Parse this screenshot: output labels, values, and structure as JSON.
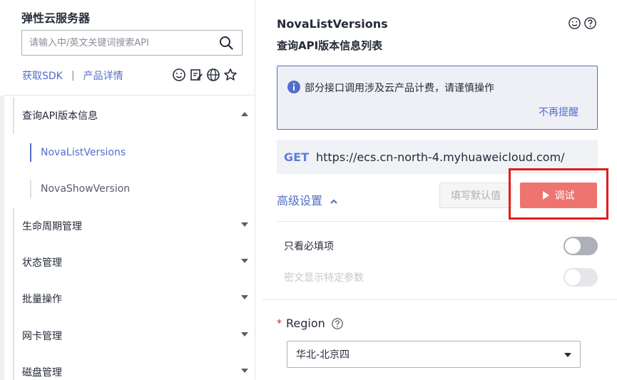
{
  "sidebar": {
    "title": "弹性云服务器",
    "search_placeholder": "请输入中/英文关键词搜索API",
    "links": {
      "sdk": "获取SDK",
      "separator": "|",
      "details": "产品详情"
    },
    "tool_icons": [
      "smiley-icon",
      "edit-doc-icon",
      "globe-icon",
      "star-icon"
    ],
    "groups": [
      {
        "label": "查询API版本信息",
        "expanded": true,
        "items": [
          {
            "label": "NovaListVersions",
            "active": true
          },
          {
            "label": "NovaShowVersion",
            "active": false
          }
        ]
      },
      {
        "label": "生命周期管理",
        "expanded": false
      },
      {
        "label": "状态管理",
        "expanded": false
      },
      {
        "label": "批量操作",
        "expanded": false
      },
      {
        "label": "网卡管理",
        "expanded": false
      },
      {
        "label": "磁盘管理",
        "expanded": false
      }
    ]
  },
  "main": {
    "title": "NovaListVersions",
    "subtitle": "查询API版本信息列表",
    "notice": {
      "text": "部分接口调用涉及云产品计费，请谨慎操作",
      "dismiss": "不再提醒"
    },
    "request": {
      "method": "GET",
      "url": "https://ecs.cn-north-4.myhuaweicloud.com/"
    },
    "advanced_label": "高级设置",
    "fill_default_label": "填写默认值",
    "debug_label": "调试",
    "toggles": [
      {
        "label": "只看必填项",
        "on": false,
        "disabled": false
      },
      {
        "label": "密文显示特定参数",
        "on": false,
        "disabled": true
      }
    ],
    "region": {
      "label": "Region",
      "required_mark": "*",
      "value": "华北-北京四"
    }
  },
  "colors": {
    "accent": "#526ecc",
    "method": "#5e7ce0",
    "debug_button": "#ee7470",
    "highlight_box": "#e11d1d"
  }
}
